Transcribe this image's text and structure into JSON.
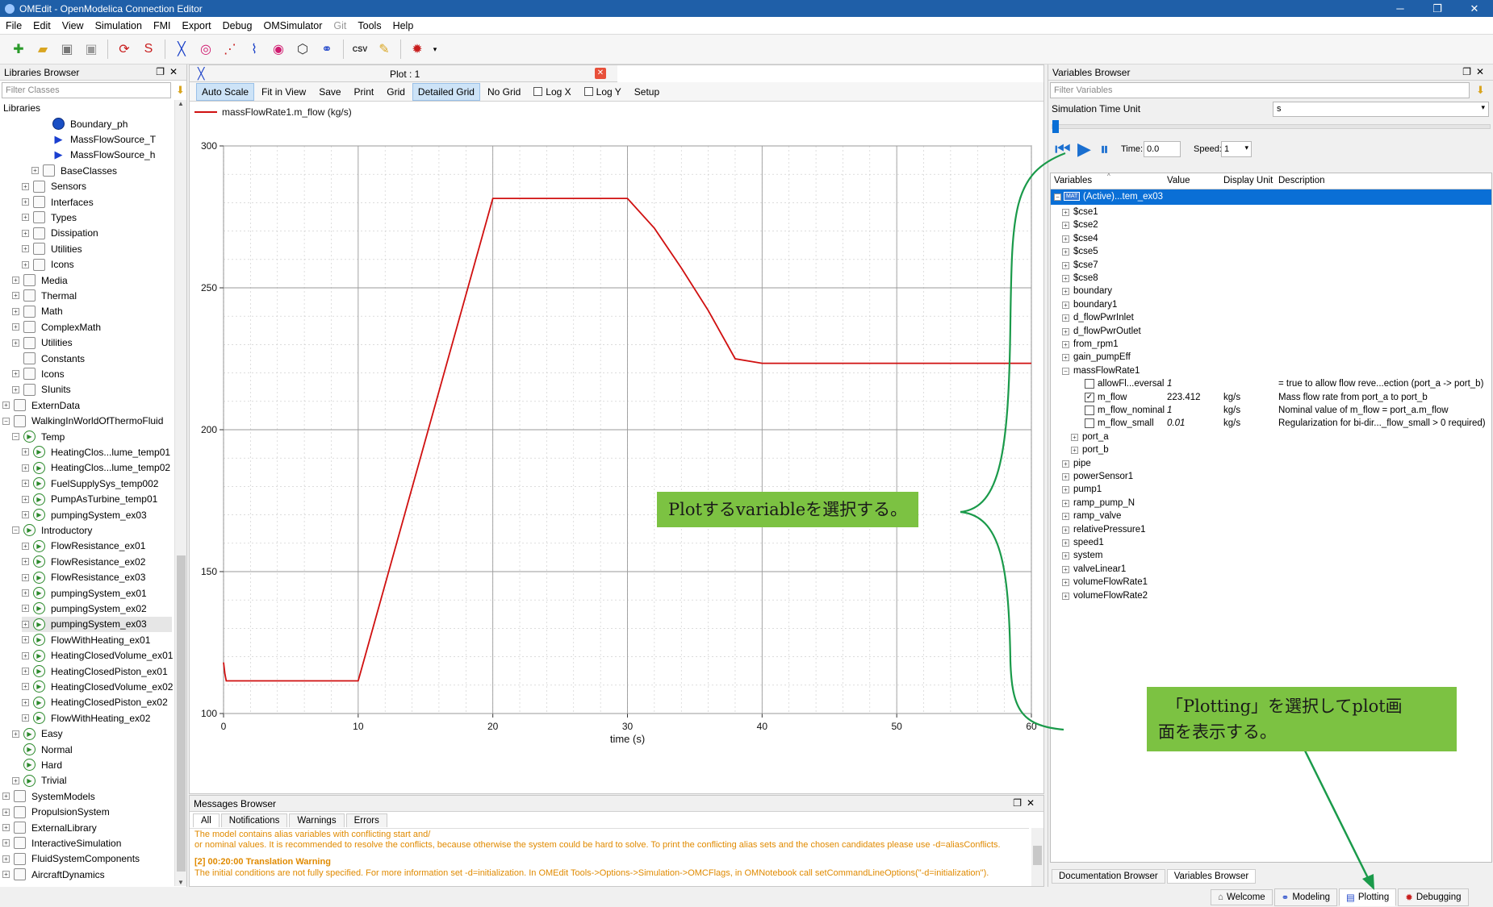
{
  "window": {
    "title": "OMEdit - OpenModelica Connection Editor",
    "controls": [
      "─",
      "❐",
      "✕"
    ]
  },
  "menu": [
    "File",
    "Edit",
    "View",
    "Simulation",
    "FMI",
    "Export",
    "Debug",
    "OMSimulator",
    "Git",
    "Tools",
    "Help"
  ],
  "libraries_browser": {
    "title": "Libraries Browser",
    "filter_placeholder": "Filter Classes",
    "root_label": "Libraries",
    "items": [
      {
        "label": "Boundary_ph",
        "icon": "blue-circle",
        "level": 4,
        "exp": ""
      },
      {
        "label": "MassFlowSource_T",
        "icon": "blue-triangle",
        "level": 4,
        "exp": ""
      },
      {
        "label": "MassFlowSource_h",
        "icon": "blue-triangle",
        "level": 4,
        "exp": ""
      },
      {
        "label": "BaseClasses",
        "icon": "box",
        "level": 3,
        "exp": "+"
      },
      {
        "label": "Sensors",
        "icon": "box",
        "level": 2,
        "exp": "+"
      },
      {
        "label": "Interfaces",
        "icon": "box",
        "level": 2,
        "exp": "+"
      },
      {
        "label": "Types",
        "icon": "box",
        "level": 2,
        "exp": "+"
      },
      {
        "label": "Dissipation",
        "icon": "box",
        "level": 2,
        "exp": "+"
      },
      {
        "label": "Utilities",
        "icon": "box",
        "level": 2,
        "exp": "+"
      },
      {
        "label": "Icons",
        "icon": "box",
        "level": 2,
        "exp": "+"
      },
      {
        "label": "Media",
        "icon": "box",
        "level": 1,
        "exp": "+"
      },
      {
        "label": "Thermal",
        "icon": "box",
        "level": 1,
        "exp": "+"
      },
      {
        "label": "Math",
        "icon": "box",
        "level": 1,
        "exp": "+"
      },
      {
        "label": "ComplexMath",
        "icon": "box",
        "level": 1,
        "exp": "+"
      },
      {
        "label": "Utilities",
        "icon": "box",
        "level": 1,
        "exp": "+"
      },
      {
        "label": "Constants",
        "icon": "box",
        "level": 1,
        "exp": ""
      },
      {
        "label": "Icons",
        "icon": "box",
        "level": 1,
        "exp": "+"
      },
      {
        "label": "SIunits",
        "icon": "box",
        "level": 1,
        "exp": "+"
      },
      {
        "label": "ExternData",
        "icon": "box",
        "level": 0,
        "exp": "+"
      },
      {
        "label": "WalkingInWorldOfThermoFluid",
        "icon": "box",
        "level": 0,
        "exp": "−"
      },
      {
        "label": "Temp",
        "icon": "play",
        "level": 1,
        "exp": "−"
      },
      {
        "label": "HeatingClos...lume_temp01",
        "icon": "play",
        "level": 2,
        "exp": "+"
      },
      {
        "label": "HeatingClos...lume_temp02",
        "icon": "play",
        "level": 2,
        "exp": "+"
      },
      {
        "label": "FuelSupplySys_temp002",
        "icon": "play",
        "level": 2,
        "exp": "+"
      },
      {
        "label": "PumpAsTurbine_temp01",
        "icon": "play",
        "level": 2,
        "exp": "+"
      },
      {
        "label": "pumpingSystem_ex03",
        "icon": "play",
        "level": 2,
        "exp": "+"
      },
      {
        "label": "Introductory",
        "icon": "play",
        "level": 1,
        "exp": "−"
      },
      {
        "label": "FlowResistance_ex01",
        "icon": "play",
        "level": 2,
        "exp": "+"
      },
      {
        "label": "FlowResistance_ex02",
        "icon": "play",
        "level": 2,
        "exp": "+"
      },
      {
        "label": "FlowResistance_ex03",
        "icon": "play",
        "level": 2,
        "exp": "+"
      },
      {
        "label": "pumpingSystem_ex01",
        "icon": "play",
        "level": 2,
        "exp": "+"
      },
      {
        "label": "pumpingSystem_ex02",
        "icon": "play",
        "level": 2,
        "exp": "+"
      },
      {
        "label": "pumpingSystem_ex03",
        "icon": "play",
        "level": 2,
        "exp": "+",
        "selected": true
      },
      {
        "label": "FlowWithHeating_ex01",
        "icon": "play",
        "level": 2,
        "exp": "+"
      },
      {
        "label": "HeatingClosedVolume_ex01",
        "icon": "play",
        "level": 2,
        "exp": "+"
      },
      {
        "label": "HeatingClosedPiston_ex01",
        "icon": "play",
        "level": 2,
        "exp": "+"
      },
      {
        "label": "HeatingClosedVolume_ex02",
        "icon": "play",
        "level": 2,
        "exp": "+"
      },
      {
        "label": "HeatingClosedPiston_ex02",
        "icon": "play",
        "level": 2,
        "exp": "+"
      },
      {
        "label": "FlowWithHeating_ex02",
        "icon": "play",
        "level": 2,
        "exp": "+"
      },
      {
        "label": "Easy",
        "icon": "play",
        "level": 1,
        "exp": "+"
      },
      {
        "label": "Normal",
        "icon": "play",
        "level": 1,
        "exp": ""
      },
      {
        "label": "Hard",
        "icon": "play",
        "level": 1,
        "exp": ""
      },
      {
        "label": "Trivial",
        "icon": "play",
        "level": 1,
        "exp": "+"
      },
      {
        "label": "SystemModels",
        "icon": "box",
        "level": 0,
        "exp": "+"
      },
      {
        "label": "PropulsionSystem",
        "icon": "box",
        "level": 0,
        "exp": "+"
      },
      {
        "label": "ExternalLibrary",
        "icon": "box",
        "level": 0,
        "exp": "+"
      },
      {
        "label": "InteractiveSimulation",
        "icon": "box",
        "level": 0,
        "exp": "+"
      },
      {
        "label": "FluidSystemComponents",
        "icon": "box",
        "level": 0,
        "exp": "+"
      },
      {
        "label": "AircraftDynamics",
        "icon": "box",
        "level": 0,
        "exp": "+"
      }
    ]
  },
  "plot_window": {
    "tab_title": "Plot : 1",
    "toolbar": [
      {
        "label": "Auto Scale",
        "on": true
      },
      {
        "label": "Fit in View"
      },
      {
        "label": "Save"
      },
      {
        "label": "Print"
      },
      {
        "label": "Grid"
      },
      {
        "label": "Detailed Grid",
        "on": true
      },
      {
        "label": "No Grid"
      },
      {
        "label": "Log X",
        "check": true
      },
      {
        "label": "Log Y",
        "check": true
      },
      {
        "label": "Setup"
      }
    ]
  },
  "chart_data": {
    "type": "line",
    "xlabel": "time (s)",
    "ylabel": "",
    "xlim": [
      0,
      60
    ],
    "ylim": [
      100,
      300
    ],
    "xticks": [
      0,
      10,
      20,
      30,
      40,
      50,
      60
    ],
    "yticks": [
      100,
      150,
      200,
      250,
      300
    ],
    "grid": "detailed",
    "legend_position": "top-left",
    "series": [
      {
        "name": "massFlowRate1.m_flow (kg/s)",
        "color": "#d01010",
        "x": [
          0,
          0.1,
          0.2,
          10,
          20,
          30,
          32,
          34,
          36,
          38,
          40,
          60
        ],
        "y": [
          118,
          114,
          111.5,
          111.5,
          281.5,
          281.5,
          271,
          257,
          242,
          225,
          223.4,
          223.4
        ]
      }
    ]
  },
  "messages_browser": {
    "title": "Messages Browser",
    "tabs": [
      "All",
      "Notifications",
      "Warnings",
      "Errors"
    ],
    "lines": [
      "The model contains alias variables with conflicting start and/",
      "or nominal values. It is recommended to resolve the conflicts, because otherwise the system could be hard to solve. To print the conflicting alias sets and the chosen candidates please use -d=aliasConflicts.",
      "[2] 00:20:00 Translation Warning",
      "The initial conditions are not fully specified. For more information set -d=initialization. In OMEdit Tools->Options->Simulation->OMCFlags, in OMNotebook call setCommandLineOptions(\"-d=initialization\")."
    ]
  },
  "variables_browser": {
    "title": "Variables Browser",
    "filter_placeholder": "Filter Variables",
    "time_unit_label": "Simulation Time Unit",
    "time_unit_value": "s",
    "time_label": "Time:",
    "time_value": "0.0",
    "speed_label": "Speed:",
    "speed_value": "1",
    "columns": [
      "Variables",
      "Value",
      "Display Unit",
      "Description"
    ],
    "root": "(Active)...tem_ex03",
    "root_badge": "MAT",
    "items": [
      {
        "name": "$cse1",
        "level": 1,
        "exp": "+"
      },
      {
        "name": "$cse2",
        "level": 1,
        "exp": "+"
      },
      {
        "name": "$cse4",
        "level": 1,
        "exp": "+"
      },
      {
        "name": "$cse5",
        "level": 1,
        "exp": "+"
      },
      {
        "name": "$cse7",
        "level": 1,
        "exp": "+"
      },
      {
        "name": "$cse8",
        "level": 1,
        "exp": "+"
      },
      {
        "name": "boundary",
        "level": 1,
        "exp": "+"
      },
      {
        "name": "boundary1",
        "level": 1,
        "exp": "+"
      },
      {
        "name": "d_flowPwrInlet",
        "level": 1,
        "exp": "+"
      },
      {
        "name": "d_flowPwrOutlet",
        "level": 1,
        "exp": "+"
      },
      {
        "name": "from_rpm1",
        "level": 1,
        "exp": "+"
      },
      {
        "name": "gain_pumpEff",
        "level": 1,
        "exp": "+"
      },
      {
        "name": "massFlowRate1",
        "level": 1,
        "exp": "−"
      },
      {
        "name": "allowFl...eversal",
        "level": 3,
        "check": true,
        "checked": false,
        "value": "1",
        "italic": true,
        "unit": "",
        "desc": "= true to allow flow reve...ection (port_a -> port_b)"
      },
      {
        "name": "m_flow",
        "level": 3,
        "check": true,
        "checked": true,
        "value": "223.412",
        "unit": "kg/s",
        "desc": "Mass flow rate from port_a to port_b"
      },
      {
        "name": "m_flow_nominal",
        "level": 3,
        "check": true,
        "checked": false,
        "value": "1",
        "italic": true,
        "unit": "kg/s",
        "desc": "Nominal value of m_flow = port_a.m_flow"
      },
      {
        "name": "m_flow_small",
        "level": 3,
        "check": true,
        "checked": false,
        "value": "0.01",
        "italic": true,
        "unit": "kg/s",
        "desc": "Regularization for bi-dir..._flow_small > 0 required)"
      },
      {
        "name": "port_a",
        "level": 2,
        "exp": "+"
      },
      {
        "name": "port_b",
        "level": 2,
        "exp": "+"
      },
      {
        "name": "pipe",
        "level": 1,
        "exp": "+"
      },
      {
        "name": "powerSensor1",
        "level": 1,
        "exp": "+"
      },
      {
        "name": "pump1",
        "level": 1,
        "exp": "+"
      },
      {
        "name": "ramp_pump_N",
        "level": 1,
        "exp": "+"
      },
      {
        "name": "ramp_valve",
        "level": 1,
        "exp": "+"
      },
      {
        "name": "relativePressure1",
        "level": 1,
        "exp": "+"
      },
      {
        "name": "speed1",
        "level": 1,
        "exp": "+"
      },
      {
        "name": "system",
        "level": 1,
        "exp": "+"
      },
      {
        "name": "valveLinear1",
        "level": 1,
        "exp": "+"
      },
      {
        "name": "volumeFlowRate1",
        "level": 1,
        "exp": "+"
      },
      {
        "name": "volumeFlowRate2",
        "level": 1,
        "exp": "+"
      }
    ],
    "bottom_tabs": [
      "Documentation Browser",
      "Variables Browser"
    ]
  },
  "perspectives": [
    "Welcome",
    "Modeling",
    "Plotting",
    "Debugging"
  ],
  "active_perspective": "Plotting",
  "annotations": {
    "callout1": "Plotするvariableを選択する。",
    "callout2_line1": "「Plotting」を選択してplot画",
    "callout2_line2": "面を表示する。"
  },
  "colors": {
    "accent": "#1f5fa8",
    "selection": "#0a6fd6",
    "plot_line": "#d01010",
    "callout_bg": "#7cc242",
    "arrow": "#1a9a4a"
  }
}
